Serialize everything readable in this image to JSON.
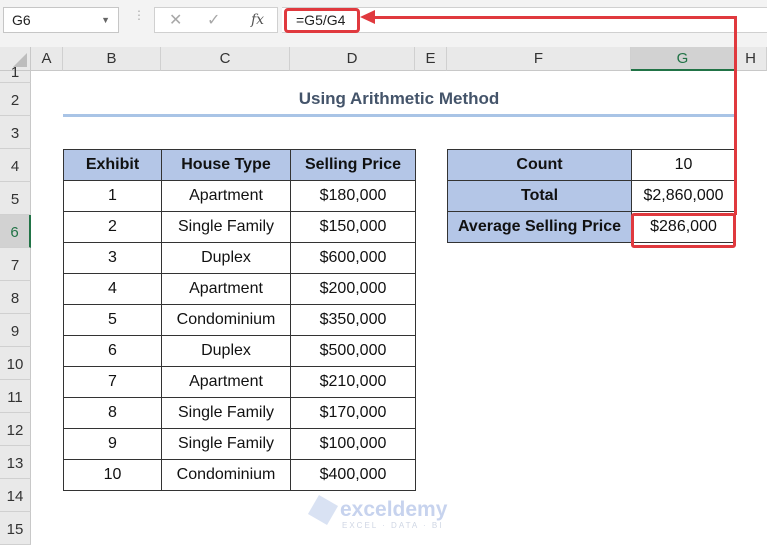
{
  "toolbar": {
    "name_box": "G6",
    "cancel_icon": "✕",
    "enter_icon": "✓",
    "fx_label": "fx",
    "formula": "=G5/G4"
  },
  "columns": [
    "A",
    "B",
    "C",
    "D",
    "E",
    "F",
    "G",
    "H"
  ],
  "selected_column": "G",
  "rows": [
    "1",
    "2",
    "3",
    "4",
    "5",
    "6",
    "7",
    "8",
    "9",
    "10",
    "11",
    "12",
    "13",
    "14",
    "15"
  ],
  "selected_row": "6",
  "title": "Using Arithmetic Method",
  "main_table": {
    "headers": [
      "Exhibit",
      "House Type",
      "Selling Price"
    ],
    "rows": [
      [
        "1",
        "Apartment",
        "$180,000"
      ],
      [
        "2",
        "Single Family",
        "$150,000"
      ],
      [
        "3",
        "Duplex",
        "$600,000"
      ],
      [
        "4",
        "Apartment",
        "$200,000"
      ],
      [
        "5",
        "Condominium",
        "$350,000"
      ],
      [
        "6",
        "Duplex",
        "$500,000"
      ],
      [
        "7",
        "Apartment",
        "$210,000"
      ],
      [
        "8",
        "Single Family",
        "$170,000"
      ],
      [
        "9",
        "Single Family",
        "$100,000"
      ],
      [
        "10",
        "Condominium",
        "$400,000"
      ]
    ]
  },
  "summary_table": {
    "rows": [
      {
        "label": "Count",
        "value": "10"
      },
      {
        "label": "Total",
        "value": "$2,860,000"
      },
      {
        "label": "Average Selling Price",
        "value": "$286,000"
      }
    ]
  },
  "watermark": {
    "name": "exceldemy",
    "tagline": "EXCEL · DATA · BI"
  },
  "colors": {
    "accent": "#e0393e",
    "header_fill": "#b4c6e7",
    "excel_green": "#217346",
    "title": "#44546a"
  }
}
